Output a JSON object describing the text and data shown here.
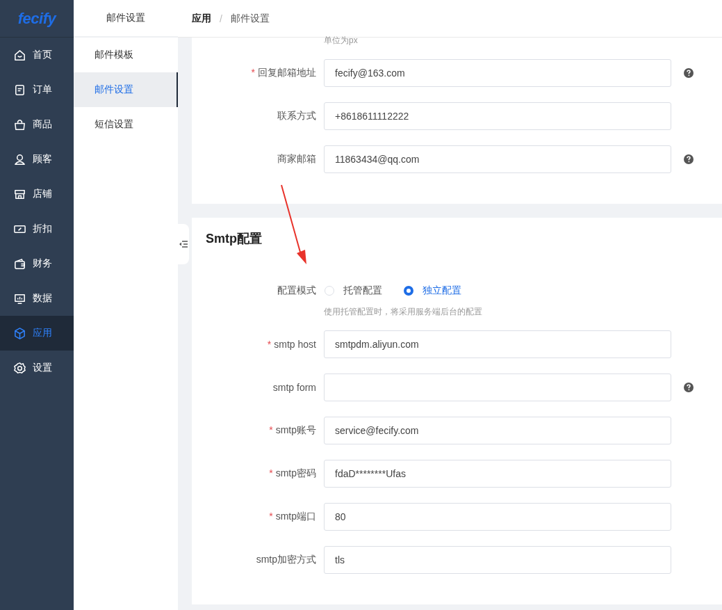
{
  "sidebar": {
    "logo": "fecify",
    "items": [
      {
        "label": "首页",
        "selected": false
      },
      {
        "label": "订单",
        "selected": false
      },
      {
        "label": "商品",
        "selected": false
      },
      {
        "label": "顾客",
        "selected": false
      },
      {
        "label": "店铺",
        "selected": false
      },
      {
        "label": "折扣",
        "selected": false
      },
      {
        "label": "财务",
        "selected": false
      },
      {
        "label": "数据",
        "selected": false
      },
      {
        "label": "应用",
        "selected": true
      },
      {
        "label": "设置",
        "selected": false
      }
    ]
  },
  "submenu": {
    "title": "邮件设置",
    "items": [
      {
        "label": "邮件模板",
        "selected": false
      },
      {
        "label": "邮件设置",
        "selected": true
      },
      {
        "label": "短信设置",
        "selected": false
      }
    ]
  },
  "breadcrumb": {
    "items": [
      "应用",
      "邮件设置"
    ],
    "separator": "/"
  },
  "email_card": {
    "hint": "单位为px",
    "fields": [
      {
        "required_mark": "*",
        "label": "回复邮箱地址",
        "value": "fecify@163.com",
        "help": true
      },
      {
        "label": "联系方式",
        "value": "+8618611112222",
        "help": false
      },
      {
        "label": "商家邮箱",
        "value": "11863434@qq.com",
        "help": true
      }
    ]
  },
  "smtp_card": {
    "title": "Smtp配置",
    "mode": {
      "label": "配置模式",
      "options": [
        {
          "label": "托管配置",
          "selected": false
        },
        {
          "label": "独立配置",
          "selected": true
        }
      ],
      "hint": "使用托管配置时，将采用服务端后台的配置"
    },
    "fields": [
      {
        "required_mark": "*",
        "label": "smtp host",
        "value": "smtpdm.aliyun.com",
        "help": false
      },
      {
        "label": "smtp form",
        "help": true
      },
      {
        "required_mark": "*",
        "label": "smtp账号",
        "value": "service@fecify.com",
        "help": false
      },
      {
        "required_mark": "*",
        "label": "smtp密码",
        "value": "fdaD********Ufas",
        "help": false
      },
      {
        "required_mark": "*",
        "label": "smtp端口",
        "value": "80",
        "help": false
      },
      {
        "label": "smtp加密方式",
        "value": "tls",
        "help": false
      }
    ]
  }
}
